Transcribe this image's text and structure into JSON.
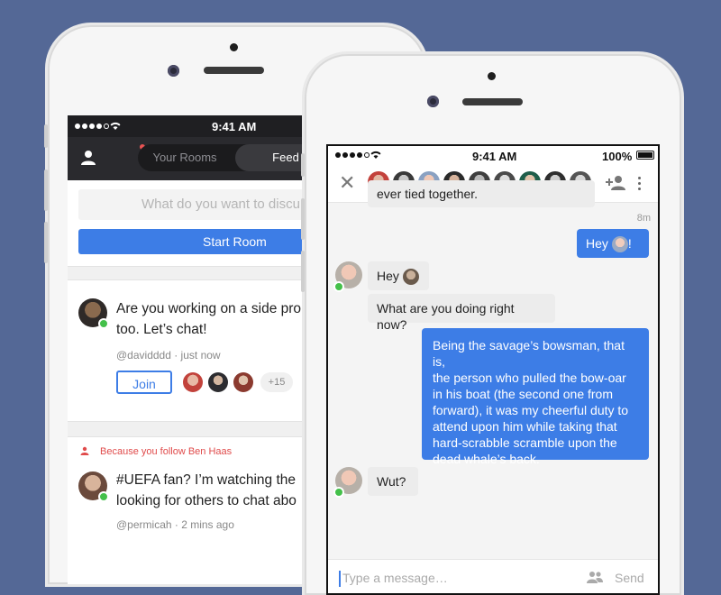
{
  "back_screen": {
    "status_bar": {
      "time": "9:41 AM"
    },
    "tabs": [
      {
        "label": "Your Rooms"
      },
      {
        "label": "Feed"
      }
    ],
    "compose": {
      "placeholder": "What do you want to discu",
      "start_button": "Start Room"
    },
    "posts": [
      {
        "text_line1": "Are you working on a side pro",
        "text_line2": "too. Let’s chat!",
        "meta": "@davidddd · just now",
        "join_label": "Join",
        "more_count": "+15"
      },
      {
        "follow_reason": "Because you follow Ben Haas",
        "text_line1": "#UEFA fan? I’m watching the",
        "text_line2": "looking for others to chat abo",
        "meta": "@permicah · 2 mins ago"
      }
    ]
  },
  "front_screen": {
    "status_bar": {
      "time": "9:41 AM",
      "battery": "100%"
    },
    "header": {
      "close": "✕"
    },
    "messages": [
      {
        "text": "ever tied together.",
        "direction": "in"
      },
      {
        "timestamp": "8m"
      },
      {
        "text": "Hey",
        "suffix": "!",
        "direction": "out"
      },
      {
        "text": "Hey",
        "direction": "in"
      },
      {
        "text": "What are you doing right now?",
        "direction": "in"
      },
      {
        "lines": [
          "Being the savage’s bowsman, that is,",
          "the person who pulled the bow-oar",
          "in his boat (the second one from",
          "forward), it was my cheerful duty to",
          "attend upon him while taking that",
          "hard-scrabble scramble upon the",
          "dead whale’s back."
        ],
        "direction": "out"
      },
      {
        "text": "Wut?",
        "direction": "in"
      }
    ],
    "composer": {
      "placeholder": "Type a message…",
      "send_label": "Send"
    }
  },
  "colors": {
    "background": "#546896",
    "accent": "#3d7de6",
    "online": "#44c04a",
    "follow_red": "#e04b4b"
  }
}
